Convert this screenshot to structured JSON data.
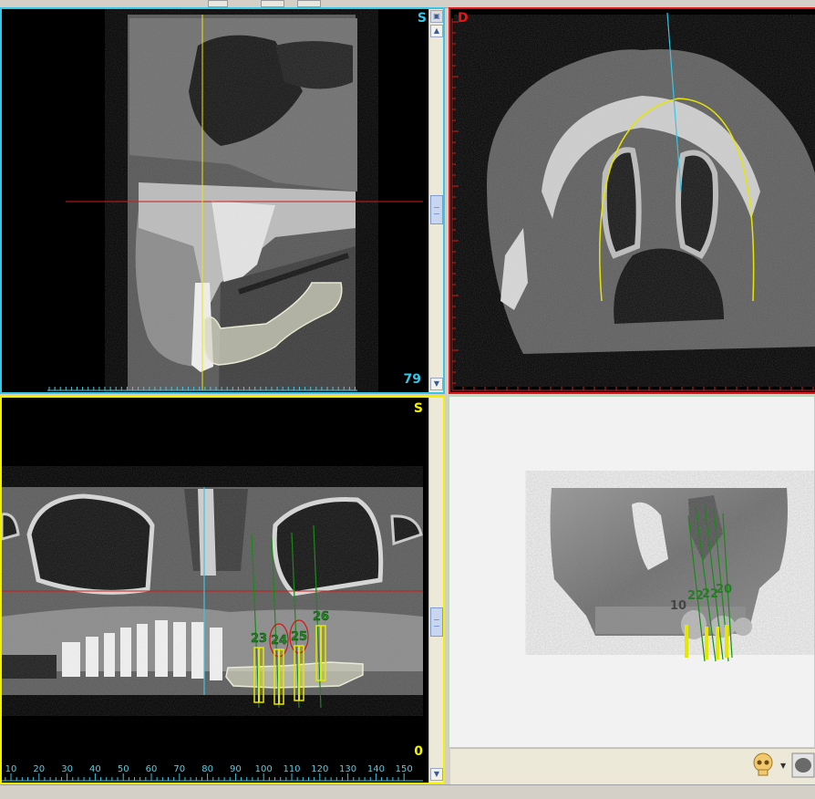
{
  "viewports": {
    "sagittal": {
      "orientation_label": "S",
      "slice_number": "79",
      "accent": "#36c6e6"
    },
    "axial": {
      "orientation_label": "D",
      "accent": "#e01818"
    },
    "panoramic": {
      "orientation_label": "S",
      "slice_number": "0",
      "accent": "#f2f200",
      "ruler_labels": [
        "10",
        "20",
        "30",
        "40",
        "50",
        "60",
        "70",
        "80",
        "90",
        "100",
        "110",
        "120",
        "130",
        "140",
        "150"
      ],
      "implants": [
        {
          "label": "23",
          "color": "#1a8a1a"
        },
        {
          "label": "24",
          "color": "#1a8a1a"
        },
        {
          "label": "25",
          "color": "#1a8a1a"
        },
        {
          "label": "26",
          "color": "#1a8a1a"
        }
      ]
    },
    "render3d": {
      "background": "#f2f2f2",
      "labels": [
        "10",
        "22",
        "22",
        "20"
      ]
    }
  },
  "icons": {
    "scroll_up": "up-arrow-icon",
    "scroll_down": "down-arrow-icon",
    "maximize": "maximize-icon",
    "skull": "skull-icon",
    "dropdown": "chevron-down-icon",
    "render_thumb": "bone-render-icon"
  }
}
